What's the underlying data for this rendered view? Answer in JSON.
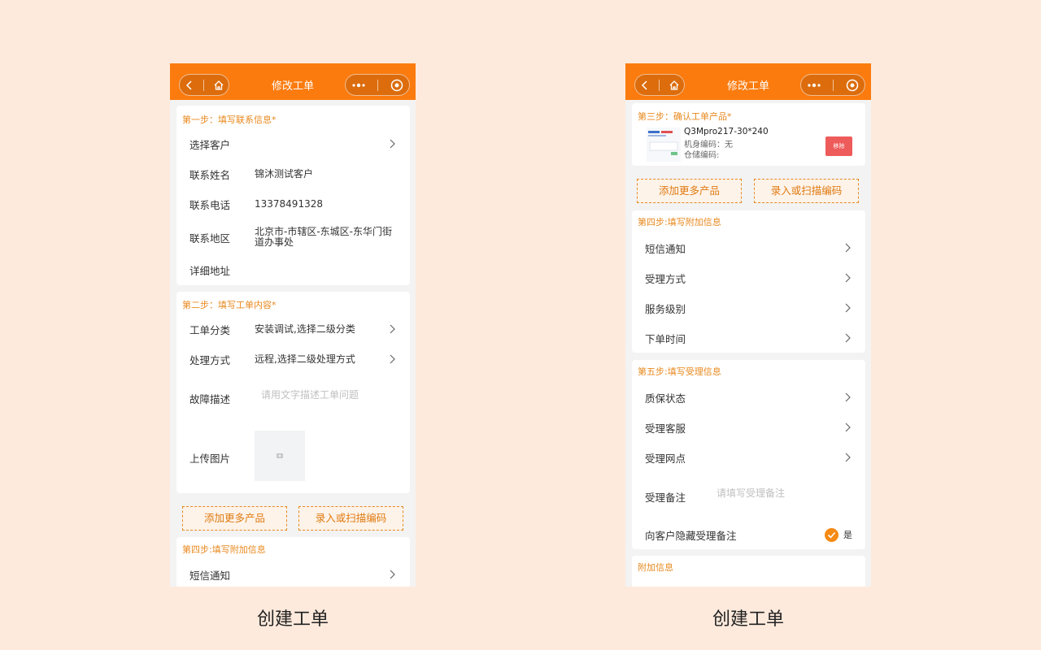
{
  "phone_left": {
    "nav": {
      "title": "修改工单"
    },
    "step1": {
      "title": "第一步：填写联系信息*",
      "rows": [
        {
          "label": "选择客户",
          "value": ""
        },
        {
          "label": "联系姓名",
          "value": "锦沐测试客户"
        },
        {
          "label": "联系电话",
          "value": "13378491328"
        },
        {
          "label": "联系地区",
          "value": "北京市-市辖区-东城区-东华门街道办事处"
        },
        {
          "label": "详细地址",
          "value": ""
        }
      ]
    },
    "step2": {
      "title": "第二步：填写工单内容*",
      "rows": [
        {
          "label": "工单分类",
          "value": "安装调试,选择二级分类"
        },
        {
          "label": "处理方式",
          "value": "远程,选择二级处理方式"
        }
      ],
      "fault_label": "故障描述",
      "fault_placeholder": "请用文字描述工单问题",
      "upload_label": "上传图片"
    },
    "buttons": {
      "add_product": "添加更多产品",
      "scan_code": "录入或扫描编码"
    },
    "step4": {
      "title": "第四步:填写附加信息",
      "rows": [
        {
          "label": "短信通知"
        }
      ]
    },
    "caption": "创建工单"
  },
  "phone_right": {
    "nav": {
      "title": "修改工单"
    },
    "step3": {
      "title": "第三步：确认工单产品*",
      "product": {
        "name": "Q3Mpro217-30*240",
        "machine_code": "机身编码：无",
        "storage_code": "仓储编码:",
        "remove_label": "移除"
      }
    },
    "buttons": {
      "add_product": "添加更多产品",
      "scan_code": "录入或扫描编码"
    },
    "step4": {
      "title": "第四步:填写附加信息",
      "rows": [
        {
          "label": "短信通知"
        },
        {
          "label": "受理方式"
        },
        {
          "label": "服务级别"
        },
        {
          "label": "下单时间"
        }
      ]
    },
    "step5": {
      "title": "第五步:填写受理信息",
      "rows": [
        {
          "label": "质保状态"
        },
        {
          "label": "受理客服"
        },
        {
          "label": "受理网点"
        }
      ],
      "remark_label": "受理备注",
      "remark_placeholder": "请填写受理备注",
      "hide_label": "向客户隐藏受理备注",
      "hide_value": "是"
    },
    "extra": {
      "title": "附加信息"
    },
    "caption": "创建工单"
  },
  "colors": {
    "background": "#fdeadc",
    "navbar": "#fb7b0e",
    "accent": "#e8891f",
    "remove": "#ee5b5b"
  }
}
